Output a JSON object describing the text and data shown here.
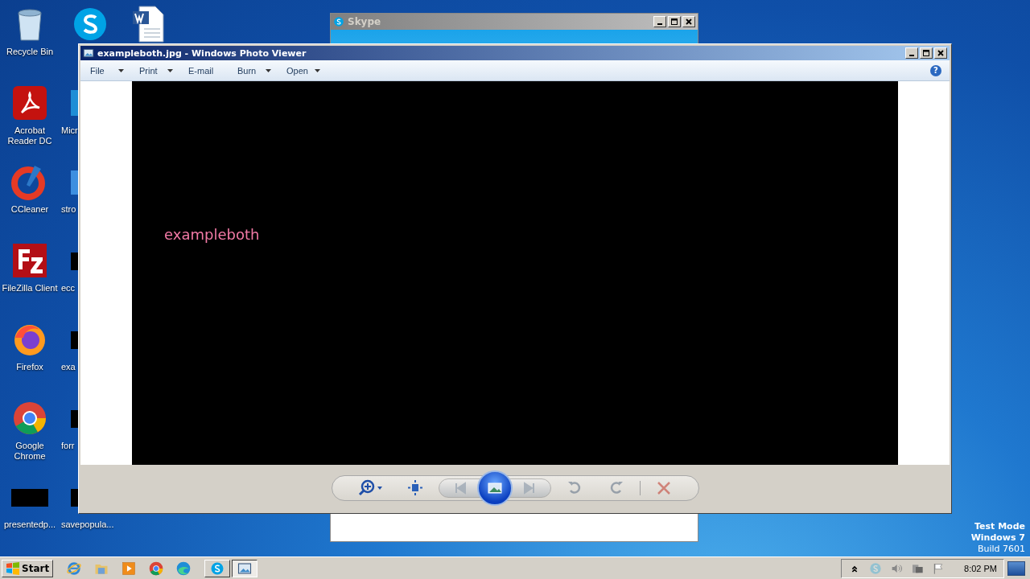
{
  "desktop": {
    "columns": [
      [
        {
          "kind": "recycle",
          "label": "Recycle Bin"
        },
        {
          "kind": "acrobat",
          "label": "Acrobat Reader DC"
        },
        {
          "kind": "ccleaner",
          "label": "CCleaner"
        },
        {
          "kind": "filezilla",
          "label": "FileZilla Client"
        },
        {
          "kind": "firefox",
          "label": "Firefox"
        },
        {
          "kind": "chrome",
          "label": "Google Chrome"
        },
        {
          "kind": "blackfile",
          "label": "presentedp..."
        }
      ],
      [
        {
          "kind": "skype"
        },
        {
          "kind": "edge",
          "label": "Micr"
        },
        {
          "kind": "blank",
          "label": "stro"
        },
        {
          "kind": "blackfile",
          "label": "ecc"
        },
        {
          "kind": "blackfile",
          "label": "exa"
        },
        {
          "kind": "blackfile",
          "label": "forr"
        },
        {
          "kind": "blackfile",
          "label": "savepopula..."
        }
      ],
      [
        {
          "kind": "word"
        }
      ]
    ],
    "system_text": [
      "Test Mode",
      "Windows 7",
      "Build 7601"
    ]
  },
  "skype_window": {
    "title": "Skype"
  },
  "photo_viewer": {
    "title": "exampleboth.jpg - Windows Photo Viewer",
    "menu": [
      {
        "label": "File",
        "dropdown": true
      },
      {
        "label": "Print",
        "dropdown": true
      },
      {
        "label": "E-mail",
        "dropdown": false
      },
      {
        "label": "Burn",
        "dropdown": true
      },
      {
        "label": "Open",
        "dropdown": true
      }
    ],
    "help": "?",
    "image_text": "exampleboth",
    "controls": [
      {
        "kind": "zoom",
        "disabled": false
      },
      {
        "kind": "fit",
        "disabled": false
      },
      {
        "kind": "previous",
        "disabled": true
      },
      {
        "kind": "slideshow",
        "disabled": false
      },
      {
        "kind": "next",
        "disabled": true
      },
      {
        "kind": "rotate-left",
        "disabled": true
      },
      {
        "kind": "rotate-right",
        "disabled": true
      },
      {
        "kind": "delete",
        "disabled": true
      }
    ]
  },
  "taskbar": {
    "start": "Start",
    "quick_launch": [
      {
        "kind": "ie"
      },
      {
        "kind": "folder"
      },
      {
        "kind": "media"
      },
      {
        "kind": "chrome"
      },
      {
        "kind": "edge"
      }
    ],
    "tasks": [
      {
        "kind": "skype",
        "selected": false
      },
      {
        "kind": "photo",
        "selected": true
      }
    ],
    "tray": [
      {
        "kind": "chevron"
      },
      {
        "kind": "skype"
      },
      {
        "kind": "speaker"
      },
      {
        "kind": "network"
      },
      {
        "kind": "flag"
      }
    ],
    "clock": "8:02 PM"
  }
}
